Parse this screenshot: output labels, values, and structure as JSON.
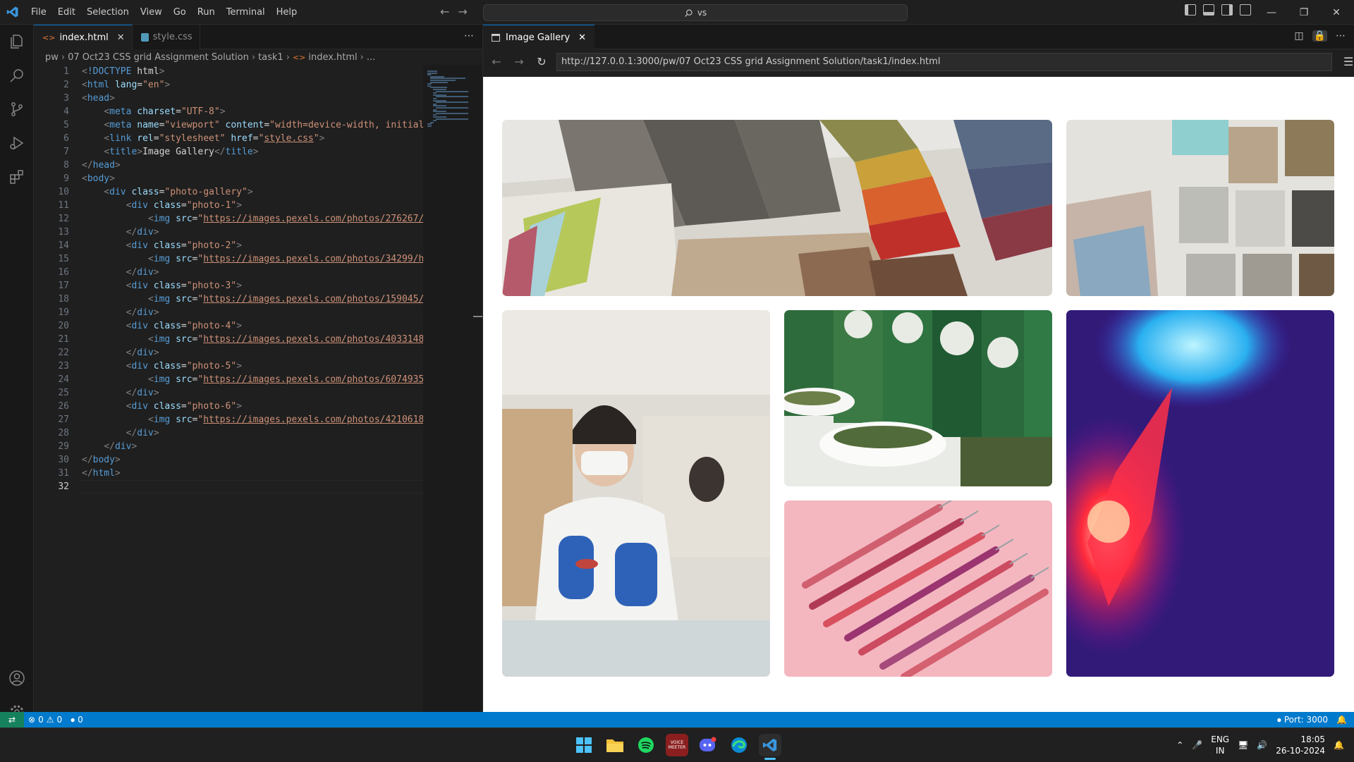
{
  "titlebar": {
    "menu": [
      "File",
      "Edit",
      "Selection",
      "View",
      "Go",
      "Run",
      "Terminal",
      "Help"
    ],
    "search_text": "vs"
  },
  "editor": {
    "tabs": [
      {
        "label": "index.html",
        "active": true
      },
      {
        "label": "style.css",
        "active": false
      }
    ],
    "breadcrumb": [
      "pw",
      "07 Oct23 CSS grid Assignment Solution",
      "task1",
      "index.html",
      "..."
    ],
    "current_line": 32,
    "lines": [
      "<!DOCTYPE html>",
      "<html lang=\"en\">",
      "<head>",
      "    <meta charset=\"UTF-8\">",
      "    <meta name=\"viewport\" content=\"width=device-width, initial-",
      "    <link rel=\"stylesheet\" href=\"style.css\">",
      "    <title>Image Gallery</title>",
      "</head>",
      "<body>",
      "    <div class=\"photo-gallery\">",
      "        <div class=\"photo-1\">",
      "            <img src=\"https://images.pexels.com/photos/276267/p",
      "        </div>",
      "        <div class=\"photo-2\">",
      "            <img src=\"https://images.pexels.com/photos/34299/he",
      "        </div>",
      "        <div class=\"photo-3\">",
      "            <img src=\"https://images.pexels.com/photos/159045/t",
      "        </div>",
      "        <div class=\"photo-4\">",
      "            <img src=\"https://images.pexels.com/photos/4033148/",
      "        </div>",
      "        <div class=\"photo-5\">",
      "            <img src=\"https://images.pexels.com/photos/6074935/",
      "        </div>",
      "        <div class=\"photo-6\">",
      "            <img src=\"https://images.pexels.com/photos/4210618/",
      "        </div>",
      "    </div>",
      "</body>",
      "</html>",
      ""
    ]
  },
  "browser": {
    "tab_label": "Image Gallery",
    "url": "http://127.0.0.1:3000/pw/07 Oct23 CSS grid Assignment Solution/task1/index.html",
    "photos": [
      {
        "name": "photo-1",
        "subject": "fabric swatches"
      },
      {
        "name": "photo-2",
        "subject": "stone tile samples"
      },
      {
        "name": "photo-3",
        "subject": "lab scientist"
      },
      {
        "name": "photo-4",
        "subject": "herb jars"
      },
      {
        "name": "photo-5",
        "subject": "colored lights"
      },
      {
        "name": "photo-6",
        "subject": "syringes"
      }
    ]
  },
  "statusbar": {
    "errors": "0",
    "warnings": "0",
    "ports": "0",
    "port_label": "Port: 3000"
  },
  "taskbar": {
    "lang_line1": "ENG",
    "lang_line2": "IN",
    "time": "18:05",
    "date": "26-10-2024",
    "voicemeeter_label": "VOICE MEETER"
  },
  "colors": {
    "accent": "#0078d4",
    "statusbar": "#007acc",
    "remote": "#16825d"
  }
}
